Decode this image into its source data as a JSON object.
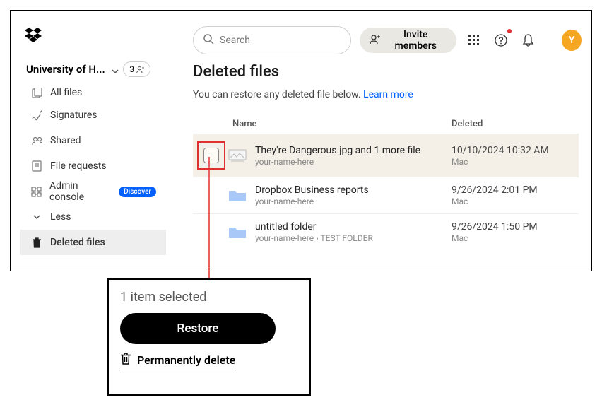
{
  "header": {
    "search_placeholder": "Search",
    "invite_label": "Invite members",
    "avatar_initial": "Y"
  },
  "team": {
    "name": "University of H...",
    "count": "3"
  },
  "sidebar": {
    "items": [
      {
        "label": "All files"
      },
      {
        "label": "Signatures"
      },
      {
        "label": "Shared"
      },
      {
        "label": "File requests"
      },
      {
        "label": "Admin console",
        "badge": "Discover"
      },
      {
        "label": "Less"
      },
      {
        "label": "Deleted files"
      }
    ]
  },
  "page": {
    "title": "Deleted files",
    "subtitle_text": "You can restore any deleted file below. ",
    "learn_more": "Learn more",
    "col_name": "Name",
    "col_deleted": "Deleted"
  },
  "rows": [
    {
      "name": "They're Dangerous.jpg and 1 more file",
      "sub": "your-name-here",
      "date": "10/10/2024 10:32 AM",
      "device": "Mac"
    },
    {
      "name": "Dropbox Business reports",
      "sub": "your-name-here",
      "date": "9/26/2024 2:01 PM",
      "device": "Mac"
    },
    {
      "name": "untitled folder",
      "sub": "your-name-here › TEST FOLDER",
      "date": "9/26/2024 1:50 PM",
      "device": "Mac"
    }
  ],
  "callout": {
    "title": "1 item selected",
    "restore_label": "Restore",
    "delete_label": "Permanently delete"
  }
}
